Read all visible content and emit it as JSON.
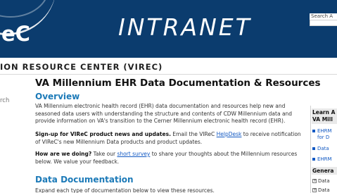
{
  "banner": {
    "logo_text": "eC",
    "title": "INTRANET",
    "search_label": "Search A"
  },
  "center_bar": {
    "name": "ION RESOURCE CENTER (VIREC)"
  },
  "left_nav": {
    "partial_item": "rch"
  },
  "main": {
    "title": "VA Millennium EHR Data Documentation & Resources",
    "overview_heading": "Overview",
    "overview_text": "VA Millennium electronic health record (EHR) data documentation and resources help new and seasoned data users with understanding the structure and contents of CDW Millennium data and provide information on VA's transition to the Cerner Millennium electronic health record (EHR).",
    "signup_bold": "Sign-up for VIReC product news and updates.",
    "signup_pre": " Email the VIReC ",
    "signup_link": "HelpDesk",
    "signup_post": " to receive notification of VIReC's new Millennium Data products and product updates.",
    "survey_bold": "How are we doing?",
    "survey_pre": " Take our ",
    "survey_link": "short survey",
    "survey_post": " to share your thoughts about the Millennium resources below. We value your feedback.",
    "docs_heading": "Data Documentation",
    "docs_text": "Expand each type of documentation below to view these resources."
  },
  "sidebar": {
    "learn_heading_1": "Learn A",
    "learn_heading_2": "VA Mill",
    "items": [
      "EHRM",
      "for D",
      "Data",
      "EHRM"
    ],
    "general_heading": "Genera",
    "general_items": [
      "Data",
      "Data"
    ]
  },
  "colors": {
    "banner_bg": "#0b3c6e",
    "heading_blue": "#1c7ab8",
    "link_blue": "#1259c3"
  }
}
